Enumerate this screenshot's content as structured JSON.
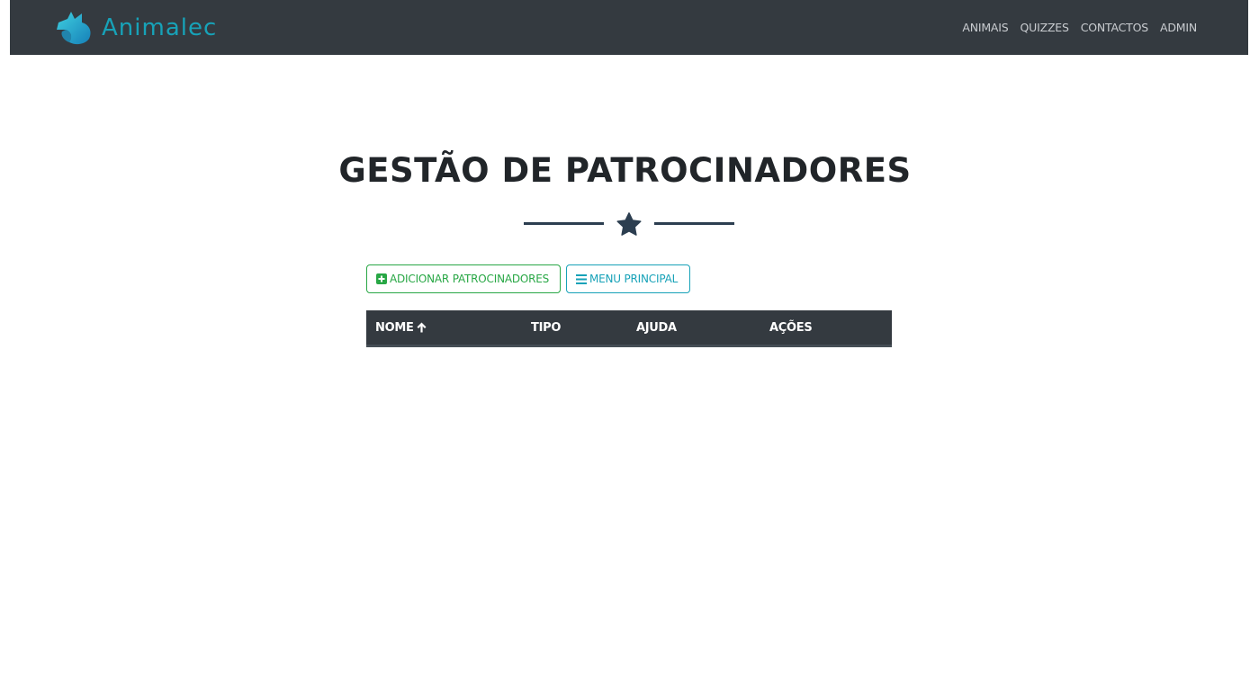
{
  "navbar": {
    "brand": "Animalec",
    "brand_icon": "dog-head-logo-icon",
    "links": [
      {
        "label": "ANIMAIS"
      },
      {
        "label": "QUIZZES"
      },
      {
        "label": "CONTACTOS"
      },
      {
        "label": "ADMIN"
      }
    ],
    "colors": {
      "background": "#343a40",
      "brand": "#17a2b8"
    }
  },
  "main": {
    "title": "GESTÃO DE PATROCINADORES",
    "divider_icon": "star-icon",
    "buttons": {
      "add_label": "ADICIONAR PATROCINADORES",
      "add_icon": "plus-square-icon",
      "menu_label": "MENU PRINCIPAL",
      "menu_icon": "bars-icon"
    },
    "table": {
      "columns": [
        {
          "label": "NOME",
          "sort_icon": "arrow-up-icon"
        },
        {
          "label": "TIPO"
        },
        {
          "label": "AJUDA"
        },
        {
          "label": "AÇÕES"
        }
      ],
      "rows": []
    },
    "colors": {
      "success": "#28a745",
      "info": "#17a2b8",
      "accent": "#2c3e50"
    }
  }
}
